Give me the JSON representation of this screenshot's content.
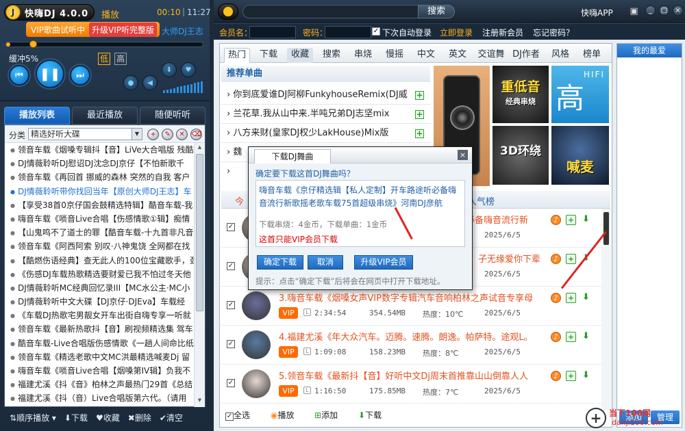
{
  "player": {
    "logo_title": "快嗨DJ 4.0.0",
    "logo_mark": "J",
    "state": "播放",
    "current_time": "00:10",
    "time_sep": "|",
    "total_time": "11:27",
    "vip_preview": "VIP歌曲试听中",
    "vip_upgrade": "升级VIP听完整版",
    "marquee": "大师DJ王志",
    "progress_fraction": 0.02,
    "buffer": "缓冲5%",
    "quality_low": "低",
    "quality_high": "高",
    "prev_glyph": "⏮",
    "play_glyph": "❚❚",
    "next_glyph": "⏭",
    "volume_level": 1.0
  },
  "left_tabs": [
    "播放列表",
    "最近播放",
    "随便听听"
  ],
  "playlist": {
    "category_label": "分类",
    "category_value": "精选好听大碟",
    "songs": [
      "领音车载《烟嗓专辑抖【音】LiVe大合唱版 残酷",
      "DJ情薇聆听DJ慰诏DJ沈念DJ京仔【不怕新歌千",
      "领音车载《再回首 挪威的森林 突然的自我 客户",
      "DJ情薇聆听带你找回当年【原创大师DJ王志】车",
      "【享受38首0京仔国会鼓精选特辑】酷音车载-我",
      "嗨音车载《唢音Live合唱【伤感情歌①辑】痴情",
      "【山鬼鸣不了道士的罪【酷音车载-十九首非凡音",
      "领音车载《阿西阿索 别叹·八神鬼饶 全网都在找",
      "【酷燃伤语经典】查无此人的100位宝藏歌手，劲",
      "《伤感DJ车载热歌精选要财爱已我不怕过冬天他",
      "DJ情薇聆听MC经典回忆录III【MC水公主·MC小",
      "DJ情薇聆听中文大碟【DJ京仔·DJEva】车载经",
      "《车载DJ热歌宅男靓女开车出街自嗨专享一听就",
      "领音车载《最新热歌抖【音】刷视频精选集 驾车",
      "酷音车载-Live合唱版伤感情歌《一趟人间命比纸",
      "领音车载《精选老歌中文MC洪最精选喊麦Dj 留",
      "嗨音车载《唢音Live合唱【烟嗓第IV辑】负我不",
      "福建尤溪《抖《音》柏林之声最热门29首《总结",
      "福建尤溪《抖（音）Live合唱版第六代。（请用"
    ],
    "current_index": 3
  },
  "left_bottom": [
    "顺序播放",
    "下载",
    "收藏",
    "删除",
    "清空"
  ],
  "topbar": {
    "search_placeholder": "",
    "search_button": "搜索",
    "app_label": "快嗨APP"
  },
  "login": {
    "member_label": "会员名：",
    "password_label": "密码：",
    "auto_login": "下次自动登录",
    "login_button": "立即登录",
    "register": "注册新会员",
    "forgot": "忘记密码？"
  },
  "nav_tabs": [
    "热门",
    "下载",
    "收藏",
    "搜索",
    "串烧",
    "慢摇",
    "中文",
    "英文",
    "交谊舞",
    "DJ作者",
    "风格",
    "榜单"
  ],
  "recommend": {
    "title": "推荐单曲",
    "items": [
      "你到底爱谁DJ阿柳FunkyhouseRemix(DJ威",
      "兰花草.我从山中来.半吨兄弟DJ志坚mix",
      "八方来财(皇家DJ权少LakHouse)Mix版",
      "魏"
    ]
  },
  "banners": {
    "heavy_bass": "重低音",
    "heavy_bass_sub": "经典串烧",
    "hifi": "HIFI",
    "hifi_big": "高清",
    "surround": "3D环绕",
    "shout": "喊麦"
  },
  "list_head": {
    "left_tab": "今",
    "right_tab": "人气榜"
  },
  "tracks": [
    {
      "title": "嗨音车载《京仔精选辑【私人定制】开车路途听必备嗨音流行新",
      "vip": "",
      "duration": "",
      "size": "",
      "heat": "",
      "date": "2025/6/5"
    },
    {
      "title": "",
      "vip": "",
      "duration": "",
      "size": "",
      "heat": "",
      "date": "2025/6/5",
      "title_tail": "子无缘爱你下辈"
    },
    {
      "title": "3.嗨音车载《烟嗓女声VIP数字专辑汽车音响柏林之声试音专享母",
      "vip": "VIP",
      "duration": "2:34:54",
      "size": "354.54MB",
      "heat": "热度：10℃",
      "date": "2025/6/5"
    },
    {
      "title": "4.福建尤溪《年大众汽车。迈腾。速腾。朗逸。帕萨特。途观L。",
      "vip": "VIP",
      "duration": "1:09:08",
      "size": "158.23MB",
      "heat": "热度：8℃",
      "date": "2025/6/5"
    },
    {
      "title": "5.领音车载《最新抖【音】好听中文Dj周末首推靠山山倒靠人人",
      "vip": "VIP",
      "duration": "1:16:50",
      "size": "175.85MB",
      "heat": "热度：7℃",
      "date": "2025/6/5"
    }
  ],
  "bottom_actions": {
    "select_all": "全选",
    "play": "播放",
    "add": "添加",
    "download": "下载"
  },
  "side": {
    "title": "我的最爱",
    "add": "添加",
    "manage": "管理"
  },
  "dialog": {
    "tab": "下载DJ舞曲",
    "close": "×",
    "question": "确定要下载这首DJ舞曲吗？",
    "song_line1": "嗨音车载《京仔精选辑【私人定制】开车路途听必备嗨",
    "song_line2": "音流行新歌摇老歌车载75首超级串烧》河南DJ彦航",
    "cost": "下载串烧：4金币，下载单曲：1金币",
    "warn": "这首只能VIP会员下载",
    "confirm": "确定下载",
    "cancel": "取消",
    "upgrade": "升级VIP会员",
    "tip": "提示：点击“确定下载”后将会在网页中打开下载地址。"
  },
  "watermark": {
    "text": "当下100网",
    "url": "danji100.com"
  },
  "colors": {
    "accent_orange": "#ffa733",
    "accent_blue": "#1e6ac0",
    "title_orange": "#e4501f",
    "vip_orange": "#ff6a00",
    "warning_red": "#dd0000"
  }
}
